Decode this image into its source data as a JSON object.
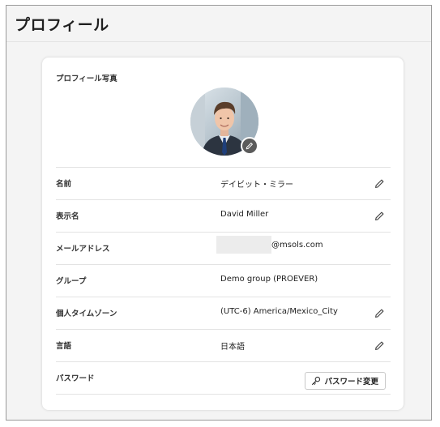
{
  "page": {
    "title": "プロフィール"
  },
  "profile": {
    "photo_section_label": "プロフィール写真",
    "rows": [
      {
        "label": "名前",
        "value": "デイビット・ミラー",
        "editable": true
      },
      {
        "label": "表示名",
        "value": "David Miller",
        "editable": true
      },
      {
        "label": "メールアドレス",
        "value": "@msols.com",
        "redacted": true,
        "editable": false
      },
      {
        "label": "グループ",
        "value": "Demo group (PROEVER)",
        "editable": false
      },
      {
        "label": "個人タイムゾーン",
        "value": "(UTC-6) America/Mexico_City",
        "editable": true
      },
      {
        "label": "言語",
        "value": "日本語",
        "editable": true
      },
      {
        "label": "パスワード",
        "value": "",
        "editable": false
      }
    ],
    "password_button_label": "パスワード変更"
  },
  "icons": {
    "edit": "pencil-icon",
    "avatar_edit": "pencil-icon",
    "password": "key-icon"
  },
  "colors": {
    "background": "#f4f4f4",
    "card": "#ffffff",
    "avatar_edit_badge": "#5b5b5b"
  }
}
